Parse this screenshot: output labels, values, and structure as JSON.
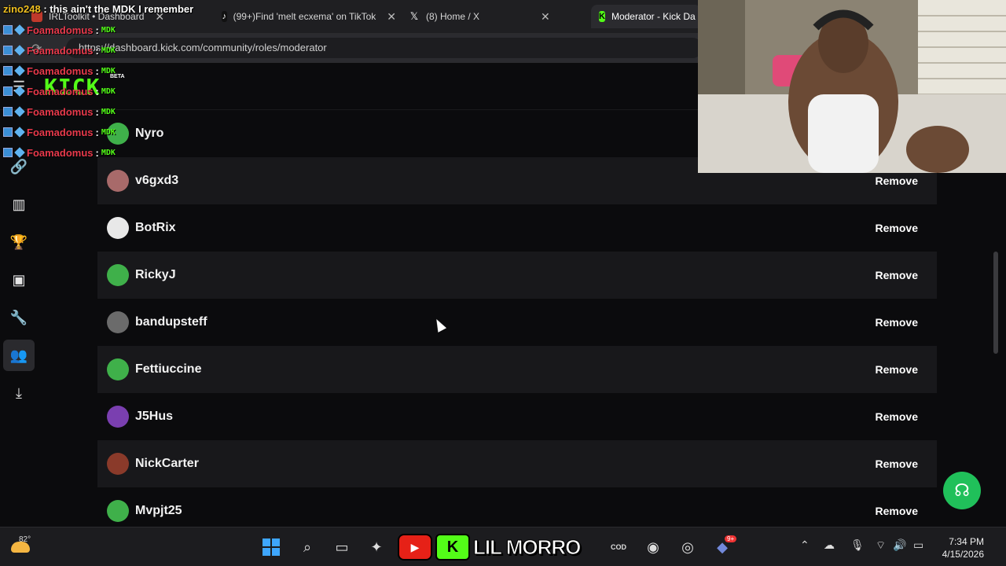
{
  "browser": {
    "tabs": [
      {
        "label": "IRLToolkit • Dashboard",
        "icon": "irltoolkit-icon"
      },
      {
        "label": "(99+)Find 'melt ecxema' on TikTok",
        "icon": "tiktok-icon"
      },
      {
        "label": "(8) Home / X",
        "icon": "x-icon"
      },
      {
        "label": "Moderator - Kick Da",
        "icon": "kick-icon",
        "active": true
      }
    ],
    "url": "https://dashboard.kick.com/community/roles/moderator"
  },
  "header": {
    "logo": "KICK",
    "beta": "BETA"
  },
  "moderators": [
    {
      "name": "Nyro",
      "avatar_color": "#3fb04a",
      "remove_label": ""
    },
    {
      "name": "v6gxd3",
      "avatar_color": "#a86a6a",
      "remove_label": "Remove"
    },
    {
      "name": "BotRix",
      "avatar_color": "#e8e8e8",
      "remove_label": "Remove"
    },
    {
      "name": "RickyJ",
      "avatar_color": "#3fb04a",
      "remove_label": "Remove"
    },
    {
      "name": "bandupsteff",
      "avatar_color": "#6b6b6b",
      "remove_label": "Remove"
    },
    {
      "name": "Fettiuccine",
      "avatar_color": "#3fb04a",
      "remove_label": "Remove"
    },
    {
      "name": "J5Hus",
      "avatar_color": "#7a3fb0",
      "remove_label": "Remove"
    },
    {
      "name": "NickCarter",
      "avatar_color": "#8a3a2a",
      "remove_label": "Remove"
    },
    {
      "name": "Mvpjt25",
      "avatar_color": "#3fb04a",
      "remove_label": "Remove"
    }
  ],
  "chat_overlay": {
    "top_user": "zino248",
    "top_message": ": this ain't the MDK I remember",
    "lines": [
      {
        "user": "Foamadomus",
        "message": "MDK"
      },
      {
        "user": "Foamadomus",
        "message": "MDK"
      },
      {
        "user": "Foamadomus",
        "message": "MDK"
      },
      {
        "user": "Foamadomus",
        "message": "MDK"
      },
      {
        "user": "Foamadomus",
        "message": "MDK"
      },
      {
        "user": "Foamadomus",
        "message": "MDK"
      },
      {
        "user": "Foamadomus",
        "message": "MDK"
      }
    ]
  },
  "taskbar": {
    "weather_temp": "82°",
    "overlay_text": "LIL MORRO",
    "time": "7:34 PM",
    "date": "4/15/2026",
    "discord_badge": "9+"
  },
  "colors": {
    "kick_green": "#53fc18",
    "support_green": "#20c05a",
    "chat_user_red": "#e8394b"
  }
}
